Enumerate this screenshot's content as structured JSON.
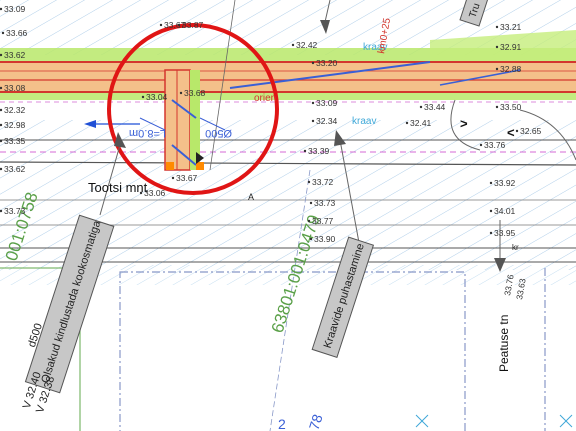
{
  "elevations": {
    "e1": "33.09",
    "e2": "33.66",
    "e3": "33.62",
    "e4": "33.08",
    "e5": "32.32",
    "e6": "32.98",
    "e7": "33.35",
    "e8": "33.62",
    "e9": "33.73",
    "e10": "33.04",
    "e11": "33.68",
    "e12": "33.67",
    "e13": "33.87",
    "e14": "32.42",
    "e15": "33.20",
    "e16": "33.09",
    "e17": "32.34",
    "e18": "33.39",
    "e19": "33.72",
    "e20": "33.73",
    "e21": "33.77",
    "e22": "33.90",
    "e23": "33.21",
    "e24": "32.91",
    "e25": "32.88",
    "e26": "33.50",
    "e27": "33.44",
    "e28": "32.41",
    "e29": "32.65",
    "e30": "33.76",
    "e31": "33.92",
    "e32": "34.01",
    "e33": "33.95",
    "e34": "33.76",
    "e35": "33.63",
    "e36": "33.67",
    "e37": "33.06"
  },
  "labels": {
    "tootsi_mnt": "Tootsi mnt",
    "peatuse_tn": "Peatuse tn",
    "parcel_left": "001:0758",
    "parcel_mid": "63801:001:0479",
    "kraav_top": "kraav",
    "kraav_mid": "kraav",
    "orient": "orien",
    "station": "km0+25",
    "point_a": "A",
    "pipe_d": "Ø500",
    "pipe_len": "L=8.0m",
    "kr_small": "kr",
    "bottom_num": "78",
    "bottom_num2": "2"
  },
  "callouts": {
    "left_box": "Olsakud kindlustada kookosmatiga",
    "mid_box": "Kraavide puhastamine",
    "top_box": "Tru",
    "side_text_1": "d500",
    "side_text_2": "V 32.40",
    "side_text_3": "V 32.38"
  },
  "colors": {
    "road_edge": "#d3362e",
    "road_fill": "#f4c08a",
    "green_band": "#b8e86a",
    "kraav": "#3ea8d8",
    "hatch": "#a9cbe8",
    "parcel": "#7bb86a",
    "circle": "#e01515",
    "pipe": "#3a5fd6",
    "callout": "#c7c7c7"
  }
}
